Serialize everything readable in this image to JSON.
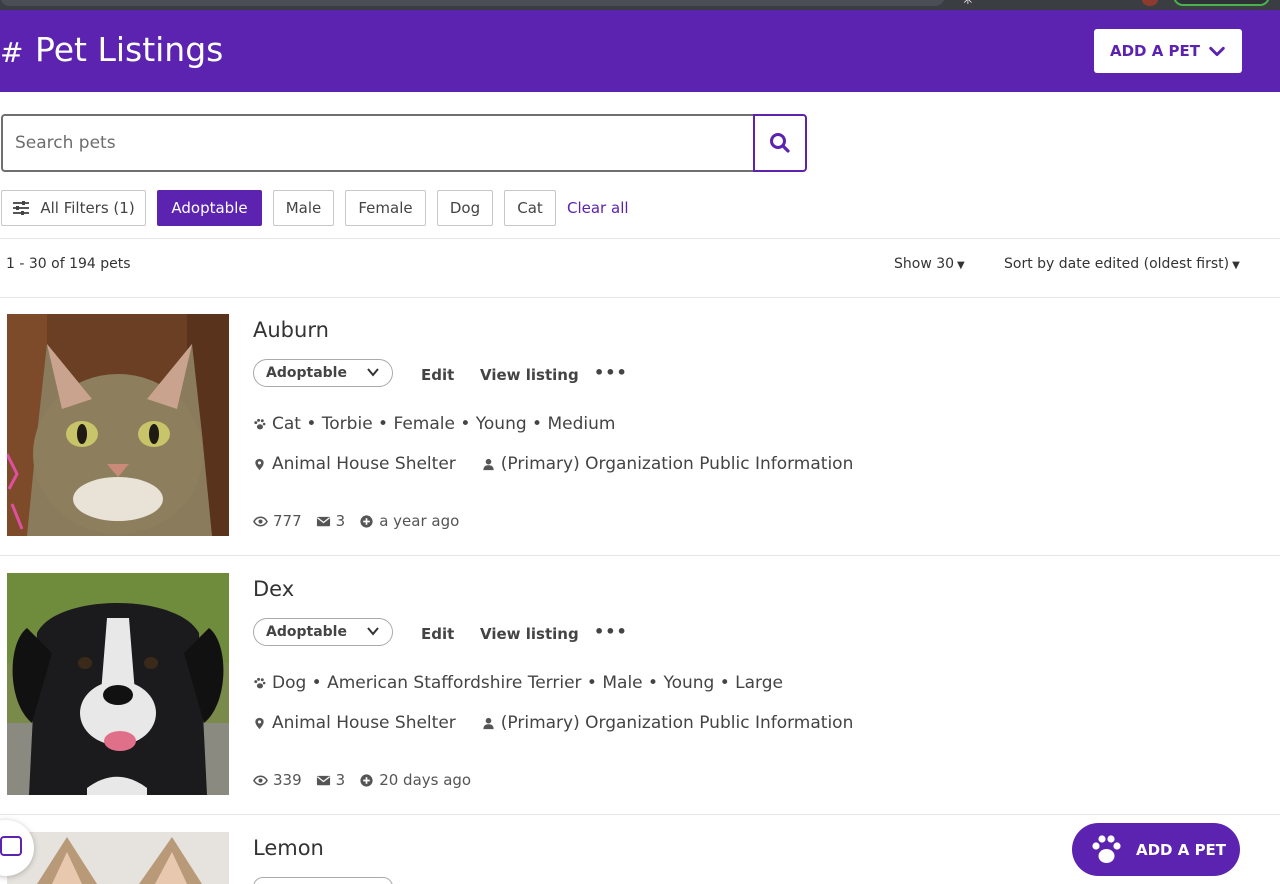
{
  "header": {
    "hash": "#",
    "title": "Pet Listings",
    "add_pet_label": "ADD A PET"
  },
  "search": {
    "placeholder": "Search pets"
  },
  "filters": {
    "all_filters_label": "All Filters (1)",
    "chips": [
      "Adoptable",
      "Male",
      "Female",
      "Dog",
      "Cat"
    ],
    "active_chip": "Adoptable",
    "clear_all_label": "Clear all"
  },
  "results": {
    "count_text": "1 - 30 of 194 pets",
    "show_label": "Show 30",
    "sort_prefix": "Sort by",
    "sort_value": "date edited (oldest first)"
  },
  "pets": [
    {
      "name": "Auburn",
      "status": "Adoptable",
      "edit_label": "Edit",
      "view_label": "View listing",
      "more_label": "•••",
      "details": "Cat • Torbie • Female • Young • Medium",
      "location": "Animal House Shelter",
      "contact": "(Primary) Organization Public Information",
      "views": "777",
      "messages": "3",
      "added": "a year ago"
    },
    {
      "name": "Dex",
      "status": "Adoptable",
      "edit_label": "Edit",
      "view_label": "View listing",
      "more_label": "•••",
      "details": "Dog • American Staffordshire Terrier • Male • Young • Large",
      "location": "Animal House Shelter",
      "contact": "(Primary) Organization Public Information",
      "views": "339",
      "messages": "3",
      "added": "20 days ago"
    },
    {
      "name": "Lemon"
    }
  ],
  "fab": {
    "label": "ADD A PET"
  },
  "colors": {
    "brand": "#5b23b0",
    "header_bg": "#5b23b0",
    "text": "#333333"
  }
}
